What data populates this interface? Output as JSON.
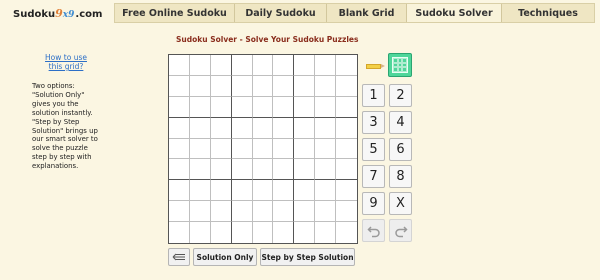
{
  "logo": {
    "prefix": "Sudoku",
    "nine": "9",
    "x9": "x9",
    "suffix": ".com"
  },
  "nav": {
    "tabs": [
      {
        "label": "Free Online Sudoku",
        "active": false
      },
      {
        "label": "Daily Sudoku",
        "active": false
      },
      {
        "label": "Blank Grid",
        "active": false
      },
      {
        "label": "Sudoku Solver",
        "active": true
      },
      {
        "label": "Techniques",
        "active": false
      }
    ]
  },
  "help": {
    "link": "How to use this grid?",
    "text": "Two options:\n\"Solution Only\"\ngives you the\nsolution instantly.\n\"Step by Step\nSolution\" brings up\nour smart solver to\nsolve the puzzle\nstep by step with\nexplanations."
  },
  "title": "Sudoku Solver - Solve Your Sudoku Puzzles",
  "numpad": {
    "keys": [
      "1",
      "2",
      "3",
      "4",
      "5",
      "6",
      "7",
      "8",
      "9",
      "X"
    ]
  },
  "icons": {
    "pencil": "pencil-icon",
    "notes": "notes-toggle-icon",
    "undo": "undo-icon",
    "redo": "redo-icon",
    "clear": "clear-lines-icon"
  },
  "actions": {
    "solution_only": "Solution Only",
    "step_by_step": "Step by Step Solution"
  },
  "colors": {
    "background": "#fbf6e2",
    "nav": "#efe6c3",
    "title": "#8a2d1d",
    "link": "#2c6fc7",
    "notes_toggle": "#4fd69a",
    "pencil": "#f3d046"
  }
}
